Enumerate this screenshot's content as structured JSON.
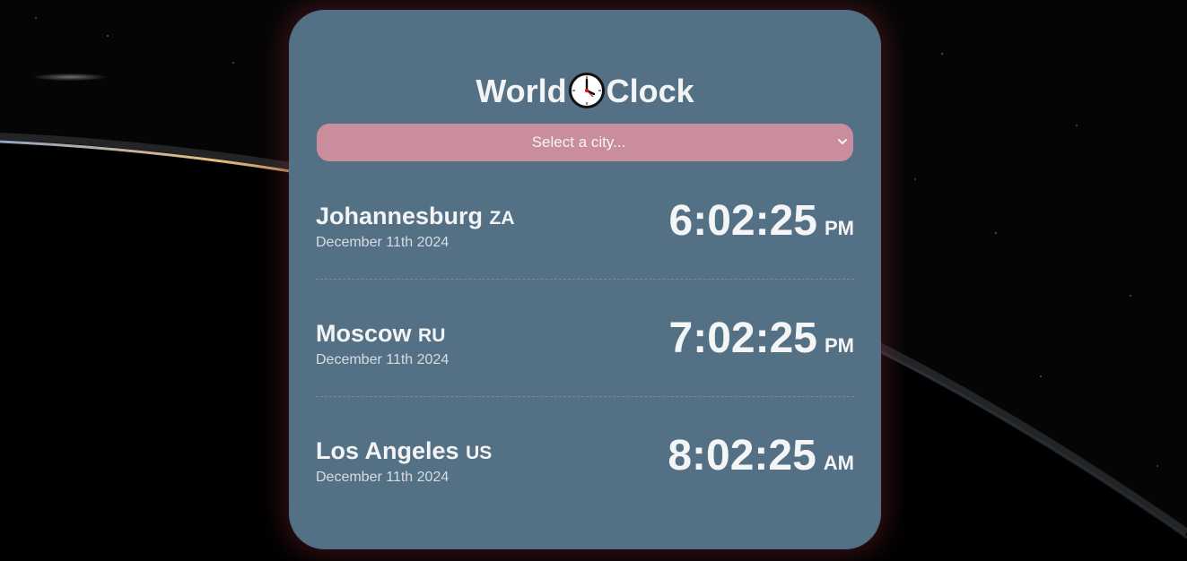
{
  "app": {
    "title_left": "World",
    "title_right": "Clock"
  },
  "icons": {
    "title_icon": "clock-icon",
    "select_icon": "chevron-down-icon"
  },
  "colors": {
    "card": "#547085",
    "select": "#c98d9b",
    "text": "#f3f4f6"
  },
  "city_select": {
    "selected_label": "Select a city..."
  },
  "cities": [
    {
      "name": "Johannesburg",
      "country": "ZA",
      "date": "December 11th 2024",
      "time": "6:02:25",
      "period": "PM"
    },
    {
      "name": "Moscow",
      "country": "RU",
      "date": "December 11th 2024",
      "time": "7:02:25",
      "period": "PM"
    },
    {
      "name": "Los Angeles",
      "country": "US",
      "date": "December 11th 2024",
      "time": "8:02:25",
      "period": "AM"
    }
  ]
}
